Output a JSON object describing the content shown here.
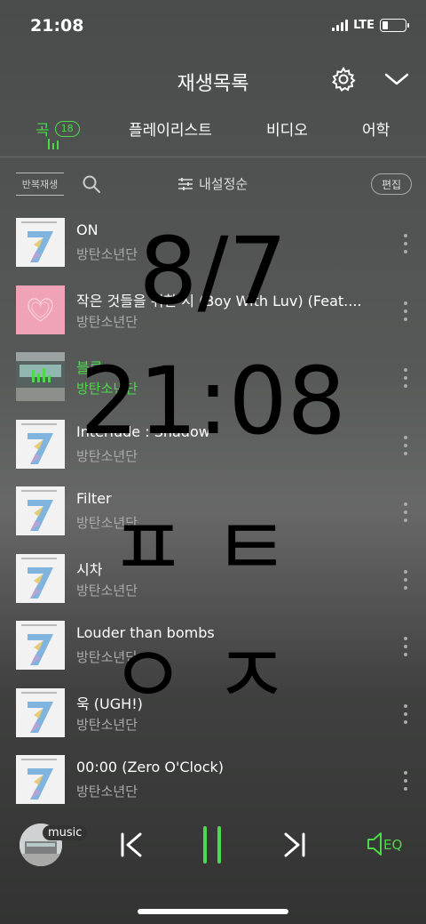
{
  "status": {
    "time": "21:08",
    "network": "LTE"
  },
  "header": {
    "title": "재생목록"
  },
  "tabs": [
    {
      "label": "곡",
      "badge": "18"
    },
    {
      "label": "플레이리스트"
    },
    {
      "label": "비디오"
    },
    {
      "label": "어학"
    }
  ],
  "toolbar": {
    "repeat_label": "반복재생",
    "sort_label": "내설정순",
    "edit_label": "편집"
  },
  "songs": [
    {
      "title": "ON",
      "artist": "방탄소년단",
      "album": "map-of-the-soul-7"
    },
    {
      "title": "작은 것들을 위한 시 (Boy With Luv) (Feat....",
      "artist": "방탄소년단",
      "album": "map-of-the-soul-persona"
    },
    {
      "title": "블루",
      "artist": "방탄소년단",
      "album": "now-playing",
      "playing": true
    },
    {
      "title": "Interlude : Shadow",
      "artist": "방탄소년단",
      "album": "map-of-the-soul-7"
    },
    {
      "title": "Filter",
      "artist": "방탄소년단",
      "album": "map-of-the-soul-7"
    },
    {
      "title": "시차",
      "artist": "방탄소년단",
      "album": "map-of-the-soul-7"
    },
    {
      "title": "Louder than bombs",
      "artist": "방탄소년단",
      "album": "map-of-the-soul-7"
    },
    {
      "title": "욱 (UGH!)",
      "artist": "방탄소년단",
      "album": "map-of-the-soul-7"
    },
    {
      "title": "00:00 (Zero O'Clock)",
      "artist": "방탄소년단",
      "album": "map-of-the-soul-7"
    }
  ],
  "overlay": {
    "date": "8/7",
    "time": "21:08",
    "line1": "ㅍㅌ",
    "line2": "ㅇㅈ"
  },
  "player": {
    "tag": "music",
    "eq_label": "EQ"
  },
  "colors": {
    "accent": "#4cd94a",
    "pink_album": "#f0a3b6"
  }
}
